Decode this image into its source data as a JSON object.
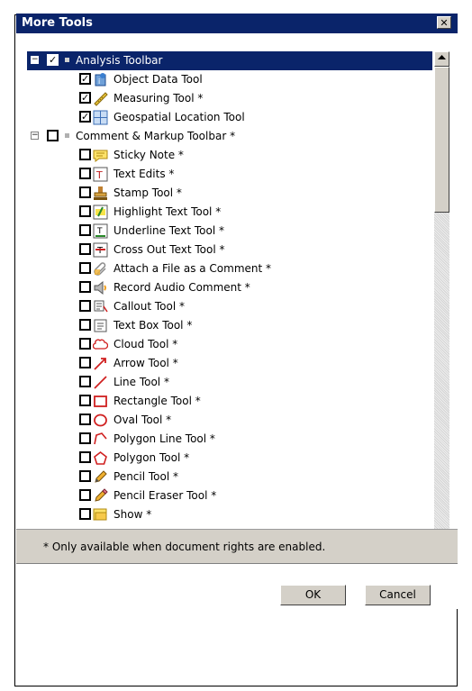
{
  "dialog": {
    "title": "More Tools",
    "close_glyph": "✕"
  },
  "tree": {
    "groups": [
      {
        "label": "Analysis Toolbar",
        "expander": "−",
        "checked": true,
        "selected": true,
        "items": [
          {
            "label": "Object Data Tool",
            "checked": true,
            "icon": "object-data-icon"
          },
          {
            "label": "Measuring Tool *",
            "checked": true,
            "icon": "ruler-icon"
          },
          {
            "label": "Geospatial Location Tool",
            "checked": true,
            "icon": "geospatial-icon"
          }
        ]
      },
      {
        "label": "Comment & Markup Toolbar *",
        "expander": "−",
        "checked": false,
        "selected": false,
        "items": [
          {
            "label": "Sticky Note *",
            "checked": false,
            "icon": "sticky-note-icon"
          },
          {
            "label": "Text Edits *",
            "checked": false,
            "icon": "text-edits-icon"
          },
          {
            "label": "Stamp Tool *",
            "checked": false,
            "icon": "stamp-icon"
          },
          {
            "label": "Highlight Text Tool *",
            "checked": false,
            "icon": "highlight-text-icon"
          },
          {
            "label": "Underline Text Tool *",
            "checked": false,
            "icon": "underline-text-icon"
          },
          {
            "label": "Cross Out Text Tool *",
            "checked": false,
            "icon": "cross-out-text-icon"
          },
          {
            "label": "Attach a File as a Comment *",
            "checked": false,
            "icon": "paperclip-icon"
          },
          {
            "label": "Record Audio Comment *",
            "checked": false,
            "icon": "speaker-icon"
          },
          {
            "label": "Callout Tool *",
            "checked": false,
            "icon": "callout-icon"
          },
          {
            "label": "Text Box Tool *",
            "checked": false,
            "icon": "text-box-icon"
          },
          {
            "label": "Cloud Tool *",
            "checked": false,
            "icon": "cloud-icon"
          },
          {
            "label": "Arrow Tool *",
            "checked": false,
            "icon": "arrow-icon"
          },
          {
            "label": "Line Tool *",
            "checked": false,
            "icon": "line-icon"
          },
          {
            "label": "Rectangle Tool *",
            "checked": false,
            "icon": "rectangle-icon"
          },
          {
            "label": "Oval Tool *",
            "checked": false,
            "icon": "oval-icon"
          },
          {
            "label": "Polygon Line Tool *",
            "checked": false,
            "icon": "polygon-line-icon"
          },
          {
            "label": "Polygon Tool *",
            "checked": false,
            "icon": "polygon-icon"
          },
          {
            "label": "Pencil Tool *",
            "checked": false,
            "icon": "pencil-icon"
          },
          {
            "label": "Pencil Eraser Tool *",
            "checked": false,
            "icon": "pencil-eraser-icon"
          },
          {
            "label": "Show *",
            "checked": false,
            "icon": "show-icon"
          }
        ]
      }
    ]
  },
  "footer": {
    "note": "* Only available when document rights are enabled.",
    "ok_label": "OK",
    "cancel_label": "Cancel"
  },
  "colors": {
    "titlebar": "#0a246a",
    "selection": "#0a246a",
    "dialog_face": "#d4d0c8"
  }
}
